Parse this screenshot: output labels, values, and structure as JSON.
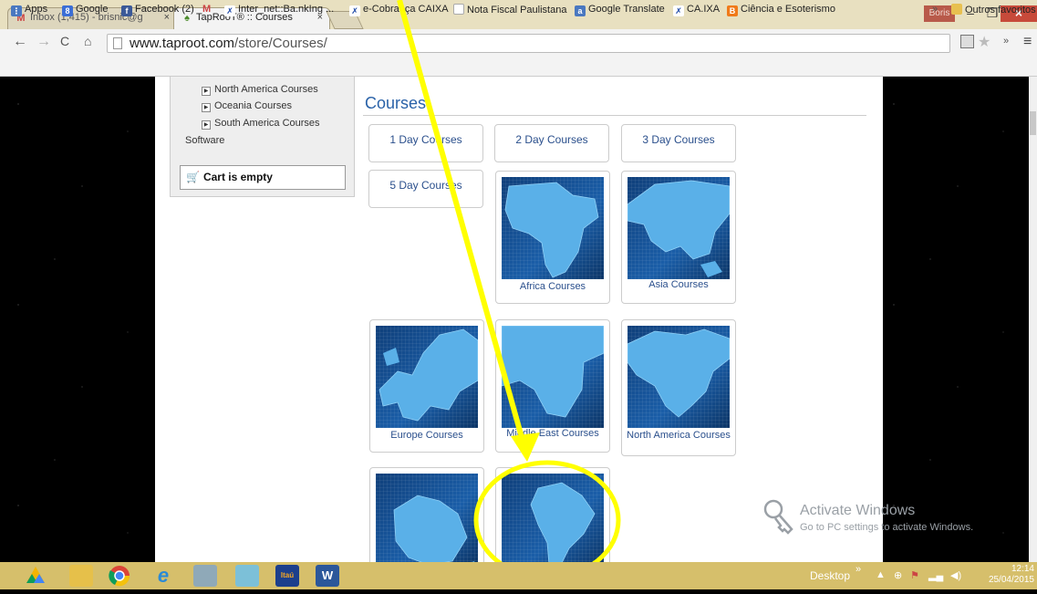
{
  "browser": {
    "tabs": [
      {
        "title": "Inbox (1,415) - brisnic@g",
        "close": "×"
      },
      {
        "title": "TapRooT® :: Courses",
        "close": "×"
      }
    ],
    "user": "Boris",
    "window_controls": {
      "minimize": "–",
      "restore": "❐",
      "close": "×"
    },
    "url_host": "www.taproot.com",
    "url_path": "/store/Courses/",
    "bookmarks": [
      {
        "label": "Apps",
        "icon": "apps-icon"
      },
      {
        "label": "Google",
        "icon": "google-icon"
      },
      {
        "label": "Facebook (2)",
        "icon": "facebook-icon"
      },
      {
        "label": "M",
        "icon": "gmail-icon"
      },
      {
        "label": "Inter_net::Ba.nkIng ...",
        "icon": "bank-icon"
      },
      {
        "label": "e-Cobrança CAIXA",
        "icon": "caixa-icon"
      },
      {
        "label": "Nota Fiscal Paulistana",
        "icon": "page-icon"
      },
      {
        "label": "Google Translate",
        "icon": "translate-icon"
      },
      {
        "label": "CA.IXA",
        "icon": "caixa-icon"
      },
      {
        "label": "Ciência e Esoterismo",
        "icon": "blogger-icon"
      }
    ],
    "bookmarks_overflow": "»",
    "other_bookmarks": "Outros favoritos"
  },
  "sidebar": {
    "sub_items": [
      "North America Courses",
      "Oceania Courses",
      "South America Courses"
    ],
    "software": "Software",
    "cart": "Cart is empty"
  },
  "main": {
    "title": "Courses",
    "buttons": [
      "1 Day Courses",
      "2 Day Courses",
      "3 Day Courses",
      "5 Day Courses"
    ],
    "cards": [
      {
        "label": "Africa Courses",
        "icon": "africa-map"
      },
      {
        "label": "Asia Courses",
        "icon": "asia-map"
      },
      {
        "label": "Europe Courses",
        "icon": "europe-map"
      },
      {
        "label": "Middle East Courses",
        "icon": "middle-east-map"
      },
      {
        "label": "North America Courses",
        "icon": "north-america-map"
      },
      {
        "label": "",
        "icon": "oceania-map"
      },
      {
        "label": "",
        "icon": "south-america-map"
      }
    ]
  },
  "watermark": {
    "title": "Activate Windows",
    "subtitle": "Go to PC settings to activate Windows."
  },
  "taskbar": {
    "desktop": "Desktop",
    "time": "12:14",
    "date": "25/04/2015",
    "apps": [
      "google-drive-icon",
      "file-explorer-icon",
      "chrome-icon",
      "internet-explorer-icon",
      "calculator-icon",
      "photos-icon",
      "itau-icon",
      "word-icon"
    ]
  },
  "colors": {
    "annotation": "#ffff00",
    "link": "#2a62a8",
    "taskbar": "#d6bf6b"
  }
}
